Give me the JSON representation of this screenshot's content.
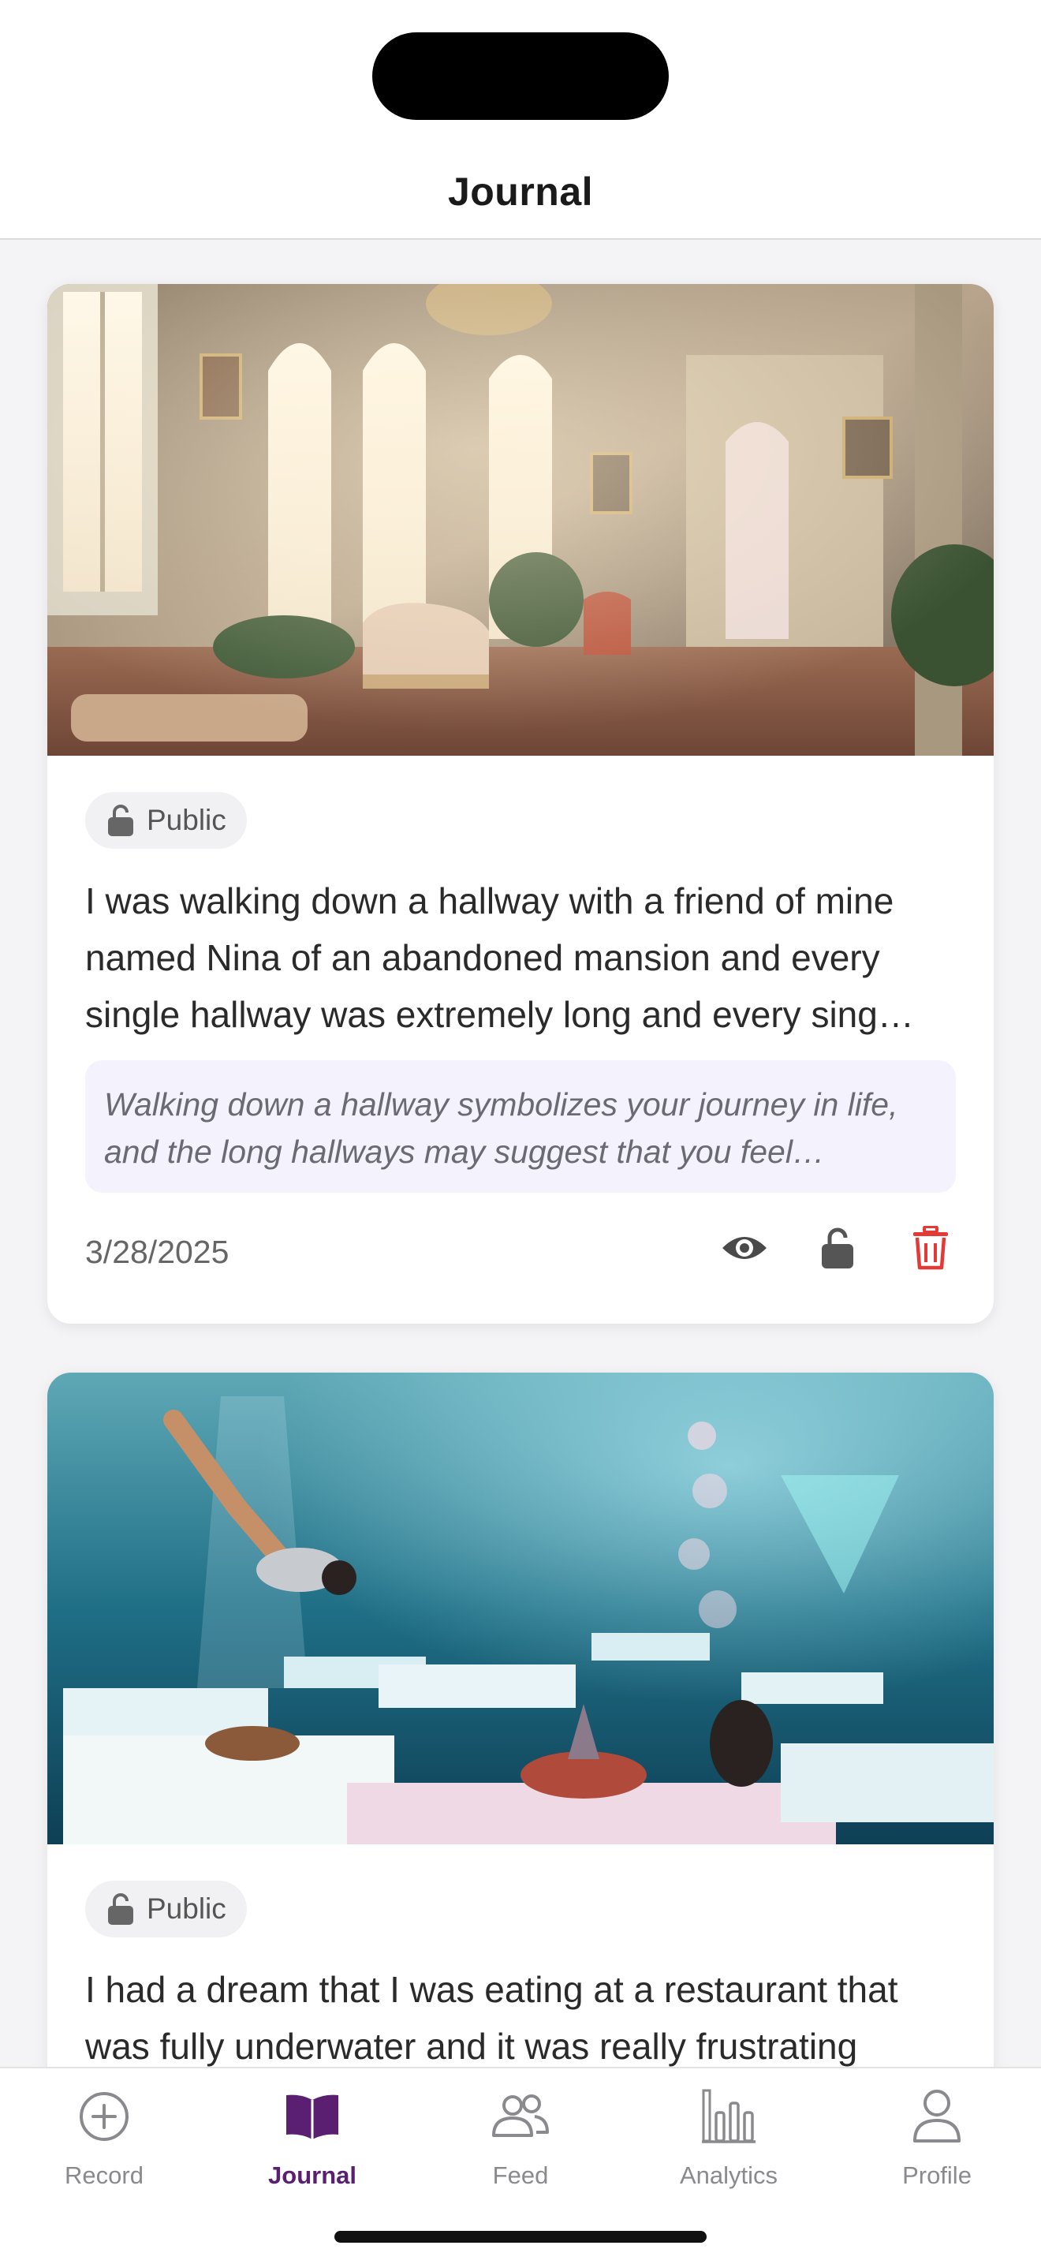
{
  "header": {
    "title": "Journal"
  },
  "entries": [
    {
      "visibility": "Public",
      "text": "I was walking down a hallway with a friend of mine named Nina of an abandoned mansion and every single hallway was extremely long and every sing…",
      "interpretation": "Walking down a hallway symbolizes your journey in life, and the long hallways may suggest that you feel…",
      "date": "3/28/2025",
      "image_icon": "ornate-mansion-hallway-illustration"
    },
    {
      "visibility": "Public",
      "text": "I had a dream that I was eating at a restaurant that was fully underwater and it was really frustrating",
      "image_icon": "underwater-restaurant-illustration"
    }
  ],
  "tabs": [
    {
      "label": "Record",
      "icon": "plus-circle-icon"
    },
    {
      "label": "Journal",
      "icon": "book-icon",
      "active": true
    },
    {
      "label": "Feed",
      "icon": "users-icon"
    },
    {
      "label": "Analytics",
      "icon": "bar-chart-icon"
    },
    {
      "label": "Profile",
      "icon": "person-icon"
    }
  ],
  "colors": {
    "accent": "#5b1f72",
    "delete": "#e53935",
    "interpretation_bg": "#f4f3fd"
  }
}
